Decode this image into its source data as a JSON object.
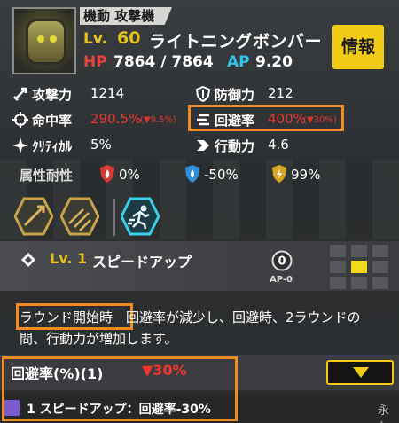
{
  "unit": {
    "type": "機動 攻撃機",
    "lv_label": "Lv.",
    "lv_value": "60",
    "name": "ライトニングボンバー",
    "hp_label": "HP",
    "hp_value": "7864 / 7864",
    "ap_label": "AP",
    "ap_value": "9.20",
    "info_button": "情報"
  },
  "stats": {
    "attack_label": "攻撃力",
    "attack_value": "1214",
    "defense_label": "防御力",
    "defense_value": "212",
    "accuracy_label": "命中率",
    "accuracy_value": "290.5%",
    "accuracy_mod": "(▼9.5%)",
    "evasion_label": "回避率",
    "evasion_value": "400%",
    "evasion_mod": "(▼30%)",
    "critical_label": "ｸﾘﾃｨｶﾙ",
    "critical_value": "5%",
    "speed_label": "行動力",
    "speed_value": "4.6"
  },
  "resist": {
    "label": "属性耐性",
    "fire": "0%",
    "ice": "-50%",
    "electric": "99%"
  },
  "skill": {
    "lv_label": "Lv. 1",
    "name": "スピードアップ",
    "ap_cost_number": "0",
    "ap_cost_label": "AP-0",
    "desc_tag": "ラウンド開始時",
    "desc_text": "　回避率が減少し、回避時、2ラウンドの間、行動力が増加します。"
  },
  "effect": {
    "title": "回避率(%)(1)",
    "value": "▼30%",
    "source": "1 スピードアップ：回避率-30%",
    "duration": "永久"
  },
  "colors": {
    "accent_yellow": "#f2cc14",
    "hp_red": "#e0443a",
    "ap_blue": "#33c2e8",
    "highlight_orange": "#f28a24",
    "debuff_red": "#f0352e"
  }
}
